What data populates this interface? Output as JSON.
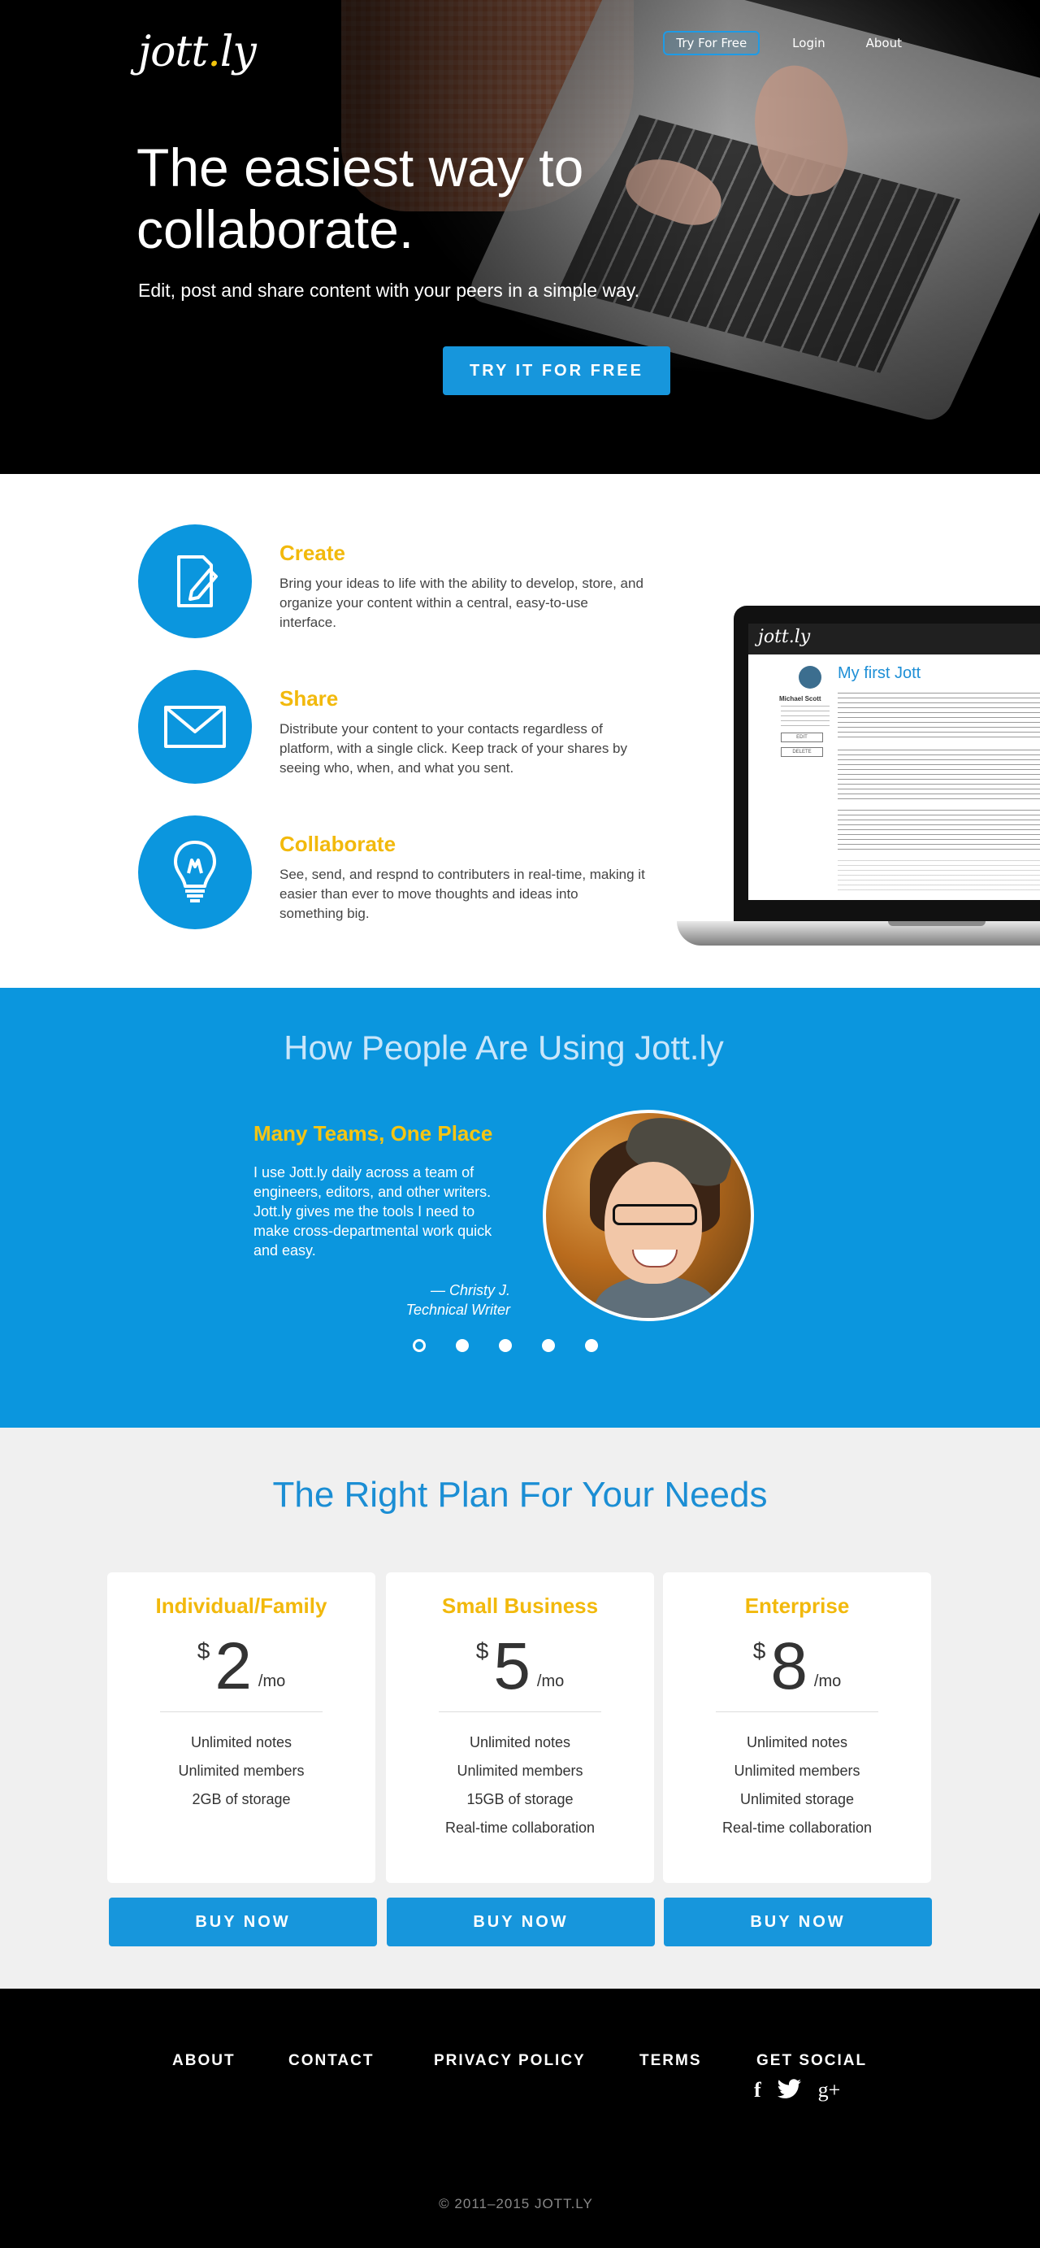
{
  "header": {
    "logo_text": "jott",
    "logo_dot": ".",
    "logo_suffix": "ly",
    "nav": {
      "cta": "Try For Free",
      "login": "Login",
      "about": "About"
    }
  },
  "hero": {
    "title": "The easiest way to collaborate.",
    "subtitle": "Edit, post and share content with your peers in a simple way.",
    "cta": "TRY IT FOR FREE"
  },
  "features": [
    {
      "title": "Create",
      "description": "Bring your ideas to life with the ability to develop, store, and organize your content within a central, easy-to-use interface.",
      "icon": "document-pencil-icon"
    },
    {
      "title": "Share",
      "description": "Distribute your content to your contacts regardless of platform, with a single click. Keep track of your shares by seeing who, when, and what you sent.",
      "icon": "envelope-icon"
    },
    {
      "title": "Collaborate",
      "description": "See, send, and respnd to contributers in real-time, making it easier than ever to move thoughts and ideas into something big.",
      "icon": "lightbulb-icon"
    }
  ],
  "laptop_preview": {
    "logo": "jott.ly",
    "doc_title": "My first Jott",
    "author": "Michael Scott",
    "edit": "EDIT",
    "delete": "DELETE"
  },
  "testimonials": {
    "heading": "How People Are Using Jott.ly",
    "title": "Many Teams, One Place",
    "quote": "I use Jott.ly daily across a team of engineers, editors, and other writers. Jott.ly gives me the tools I need to make cross-departmental work quick and easy.",
    "author": "— Christy J.",
    "role": "Technical Writer",
    "slide_count": 5,
    "active_slide": 1
  },
  "pricing": {
    "heading": "The Right Plan For Your Needs",
    "plans": [
      {
        "name": "Individual/Family",
        "currency": "$",
        "price": "2",
        "period": "/mo",
        "features": [
          "Unlimited notes",
          "Unlimited members",
          "2GB of storage",
          ""
        ],
        "cta": "BUY NOW"
      },
      {
        "name": "Small Business",
        "currency": "$",
        "price": "5",
        "period": "/mo",
        "features": [
          "Unlimited notes",
          "Unlimited members",
          "15GB of storage",
          "Real-time collaboration"
        ],
        "cta": "BUY NOW"
      },
      {
        "name": "Enterprise",
        "currency": "$",
        "price": "8",
        "period": "/mo",
        "features": [
          "Unlimited notes",
          "Unlimited members",
          "Unlimited storage",
          "Real-time collaboration"
        ],
        "cta": "BUY NOW"
      }
    ]
  },
  "footer": {
    "links": {
      "about": "ABOUT",
      "contact": "CONTACT",
      "privacy": "PRIVACY POLICY",
      "terms": "TERMS",
      "social": "GET SOCIAL"
    },
    "social": {
      "facebook": "f",
      "twitter": "twitter-bird-icon",
      "gplus": "g+"
    },
    "copyright": "© 2011–2015 JOTT.LY"
  },
  "colors": {
    "accent_blue": "#0b96de",
    "accent_yellow": "#f2b90c",
    "footer_bg": "#000000",
    "pricing_bg": "#f0f0f0"
  }
}
